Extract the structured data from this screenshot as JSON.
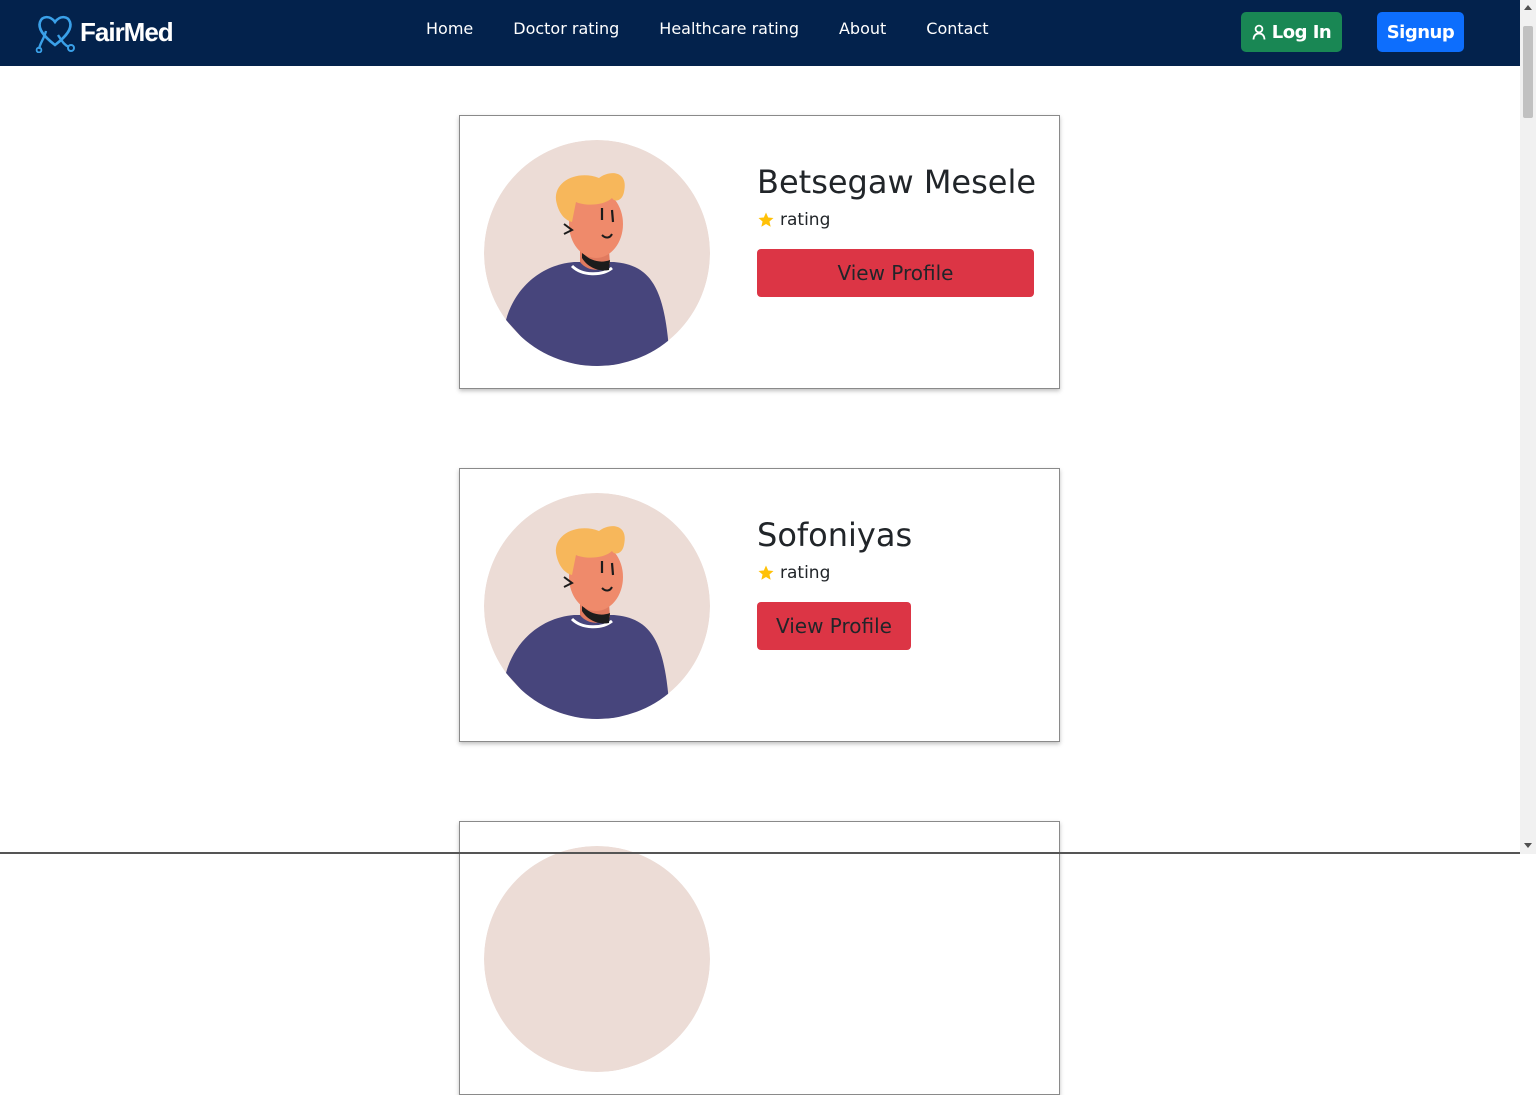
{
  "brand": {
    "name": "FairMed",
    "icon": "heart-stethoscope-icon"
  },
  "nav": {
    "links": [
      "Home",
      "Doctor rating",
      "Healthcare rating",
      "About",
      "Contact"
    ],
    "login_label": "Log In",
    "signup_label": "Signup"
  },
  "doctors": [
    {
      "name": "Betsegaw Mesele",
      "rating_label": "rating",
      "button_label": "View Profile"
    },
    {
      "name": "Sofoniyas",
      "rating_label": "rating",
      "button_label": "View Profile"
    }
  ],
  "colors": {
    "navbar": "#03224c",
    "login": "#198754",
    "signup": "#0d6efd",
    "view_profile": "#dc3545",
    "star": "#ffc107"
  }
}
